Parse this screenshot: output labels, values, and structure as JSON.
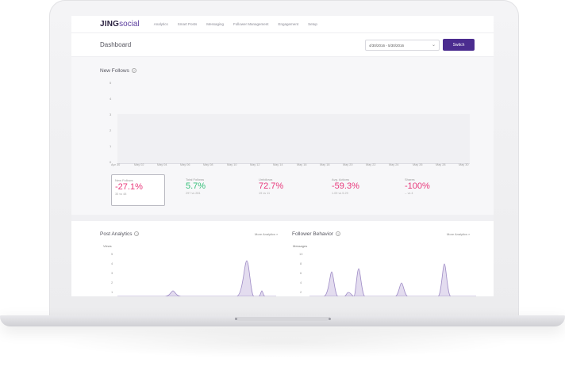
{
  "nav": {
    "logo_bold": "JING",
    "logo_light": "social",
    "items": [
      "Analytics",
      "Smart Posts",
      "Messaging",
      "Follower Management",
      "Engagement",
      "Setup"
    ]
  },
  "header": {
    "title": "Dashboard",
    "date_range": "4/30/2016 - 5/30/2016",
    "switch_label": "Switch"
  },
  "new_follows_chart": {
    "title": "New Follows",
    "y_ticks": [
      "5",
      "4",
      "3",
      "2",
      "1",
      "0"
    ],
    "x_ticks": [
      "Apr 30",
      "May 02",
      "May 04",
      "May 06",
      "May 08",
      "May 10",
      "May 12",
      "May 14",
      "May 16",
      "May 18",
      "May 20",
      "May 22",
      "May 24",
      "May 26",
      "May 28",
      "May 30"
    ]
  },
  "kpis": [
    {
      "label": "New Follows",
      "value": "-27.1%",
      "sub": "35 vs 48",
      "tone": "neg"
    },
    {
      "label": "Total Follows",
      "value": "5.7%",
      "sub": "297 vs 281",
      "tone": "pos"
    },
    {
      "label": "Unfollows",
      "value": "72.7%",
      "sub": "19 vs 11",
      "tone": "neg"
    },
    {
      "label": "Avg. Actions",
      "value": "-59.3%",
      "sub": "1.09 vs 5.29",
      "tone": "neg"
    },
    {
      "label": "Shares",
      "value": "-100%",
      "sub": "-- vs 4",
      "tone": "neg"
    }
  ],
  "post_analytics": {
    "title": "Post Analytics",
    "more": "More Analytics »",
    "axis_title": "Views",
    "y_ticks": [
      "5",
      "4",
      "3",
      "2",
      "1"
    ]
  },
  "follower_behavior": {
    "title": "Follower Behavior",
    "more": "More Analytics »",
    "axis_title": "Messages",
    "y_ticks": [
      "10",
      "8",
      "6",
      "4",
      "2"
    ]
  },
  "colors": {
    "brand_purple": "#4b2c8f",
    "negative": "#e8387b",
    "positive": "#37c07a",
    "area_fill": "#e3dcef",
    "area_stroke": "#9f8cc6"
  }
}
